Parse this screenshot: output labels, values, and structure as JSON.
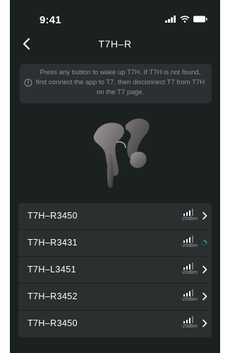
{
  "status_bar": {
    "time": "9:41"
  },
  "header": {
    "title": "T7H–R"
  },
  "notice": {
    "text": "Press any button to wake up T7H. If T7H is not found, first connect the app to T7, then disconnect T7 from T7H on the T7 page."
  },
  "devices": [
    {
      "name": "T7H–R3450",
      "signal": "-20dbm",
      "state": "chevron"
    },
    {
      "name": "T7H–R3431",
      "signal": "-20dbm",
      "state": "connecting"
    },
    {
      "name": "T7H–L3451",
      "signal": "-20dbm",
      "state": "chevron"
    },
    {
      "name": "T7H–R3452",
      "signal": "-20dbm",
      "state": "chevron"
    },
    {
      "name": "T7H–R3450",
      "signal": "-20dbm",
      "state": "chevron"
    }
  ],
  "colors": {
    "background": "#1b2021",
    "card": "#2a2f30",
    "notice_bg": "#2b3132",
    "spinner": "#3aa69a"
  },
  "icons": [
    "signal-icon",
    "wifi-icon",
    "battery-icon",
    "back-chevron-icon",
    "info-icon",
    "signal-strength-icon",
    "chevron-right-icon",
    "loading-spinner-icon"
  ]
}
